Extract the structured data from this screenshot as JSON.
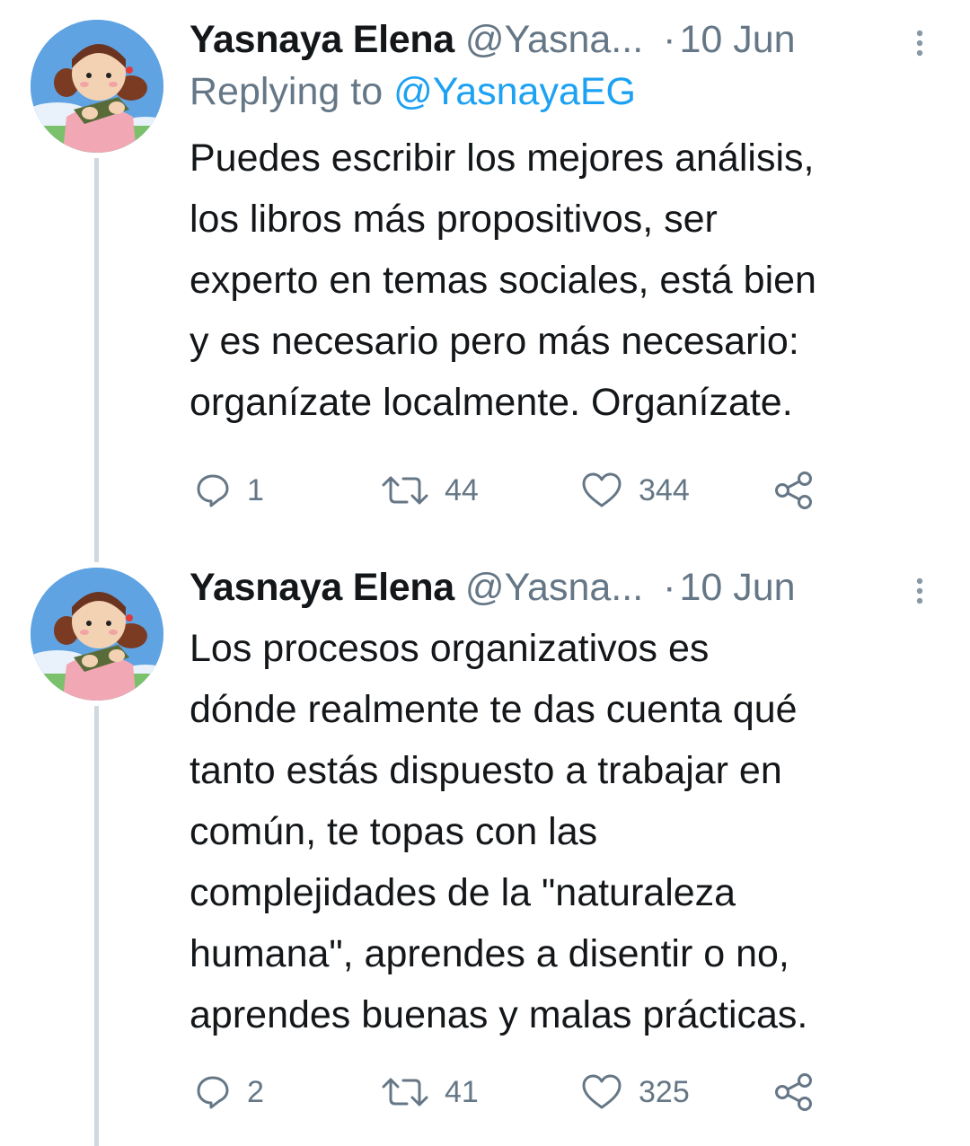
{
  "tweets": [
    {
      "display_name": "Yasnaya Elena",
      "handle": "@Yasna...",
      "separator": "·",
      "date": "10 Jun",
      "replying_prefix": "Replying to ",
      "replying_handle": "@YasnayaEG",
      "text": "Puedes escribir los mejores análisis,\nlos libros más propositivos, ser\nexperto en temas sociales, está bien\ny es necesario pero más necesario:\norganízate localmente. Organízate.",
      "replies": "1",
      "retweets": "44",
      "likes": "344"
    },
    {
      "display_name": "Yasnaya Elena",
      "handle": "@Yasna...",
      "separator": "·",
      "date": "10 Jun",
      "text": "Los procesos organizativos es\ndónde realmente te das cuenta qué\ntanto estás dispuesto a trabajar en\ncomún, te topas con las\ncomplejidades de la \"naturaleza\nhumana\", aprendes a disentir o no,\naprendes buenas y malas prácticas.",
      "replies": "2",
      "retweets": "41",
      "likes": "325"
    }
  ],
  "icons": {
    "reply": "speech-bubble-icon",
    "retweet": "retweet-icon",
    "like": "heart-icon",
    "share": "share-icon",
    "more": "vertical-dots-icon",
    "avatar": "anime-girl-avatar"
  },
  "colors": {
    "text": "#14171a",
    "secondary": "#657786",
    "link": "#1da1f2",
    "thread_line": "#cfd9de",
    "background": "#ffffff"
  }
}
